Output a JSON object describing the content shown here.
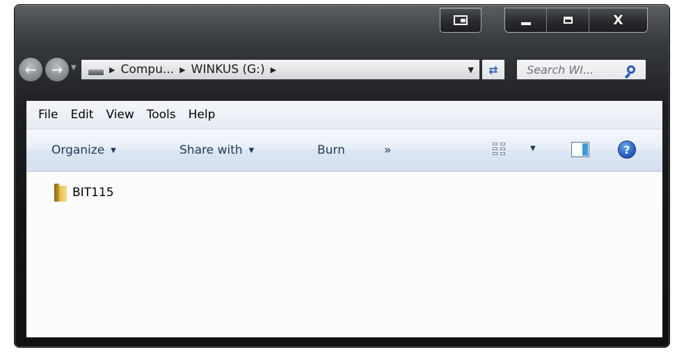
{
  "window": {
    "close_glyph": "X"
  },
  "address": {
    "crumbs": [
      "Compu...",
      "WINKUS (G:)"
    ]
  },
  "search": {
    "placeholder": "Search WI..."
  },
  "menu": {
    "items": [
      "File",
      "Edit",
      "View",
      "Tools",
      "Help"
    ]
  },
  "toolbar": {
    "organize": "Organize",
    "share_with": "Share with",
    "burn": "Burn",
    "more": "»",
    "help": "?"
  },
  "content": {
    "items": [
      {
        "name": "BIT115",
        "type": "folder"
      }
    ]
  },
  "icons": {
    "accent": "#2657b8",
    "folder": "#e5c25a"
  }
}
